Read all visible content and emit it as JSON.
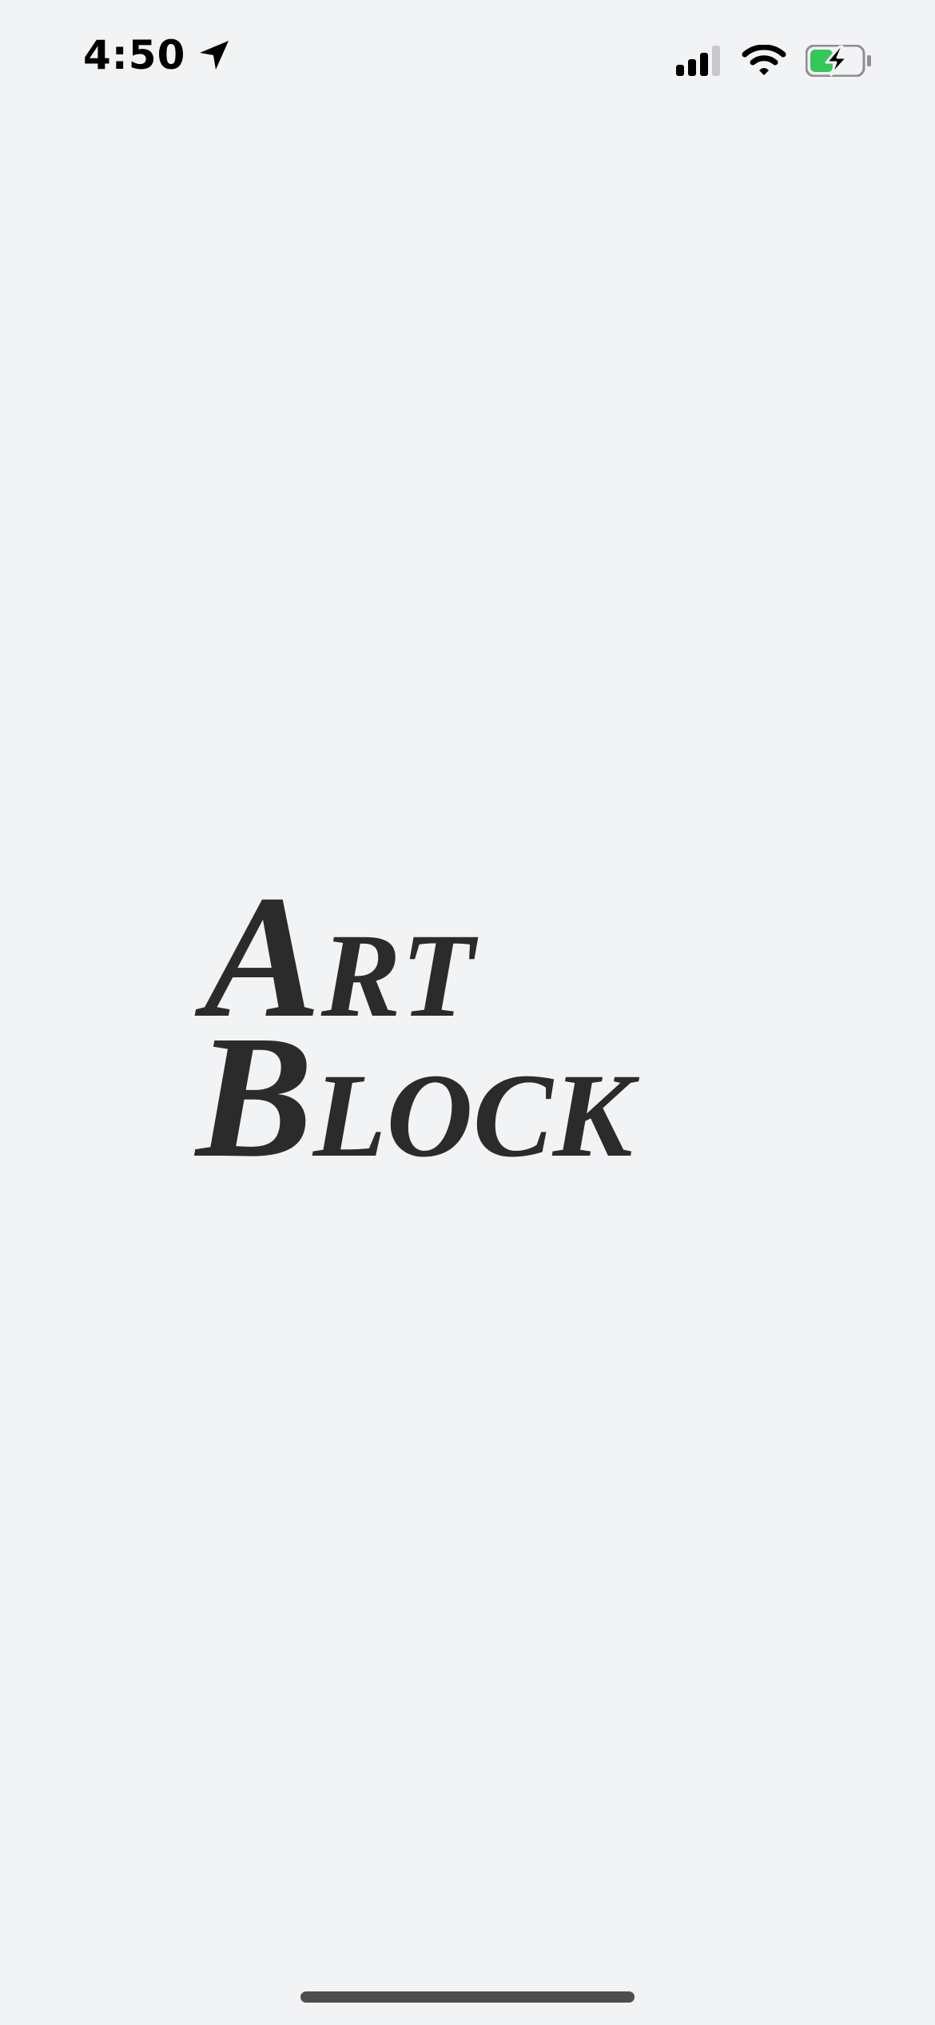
{
  "status_bar": {
    "time": "4:50",
    "icons": {
      "location": "location-arrow-icon",
      "signal": "cellular-signal-icon",
      "wifi": "wifi-icon",
      "battery": "battery-charging-icon"
    },
    "colors": {
      "battery_fill": "#34c759",
      "signal_inactive": "#c7c7cc"
    }
  },
  "logo": {
    "line1": {
      "first": "A",
      "rest": "RT"
    },
    "line2": {
      "first": "B",
      "rest": "LOCK"
    },
    "color": "#2b2b2b"
  },
  "home_indicator": {
    "color": "#4d4d4d"
  }
}
